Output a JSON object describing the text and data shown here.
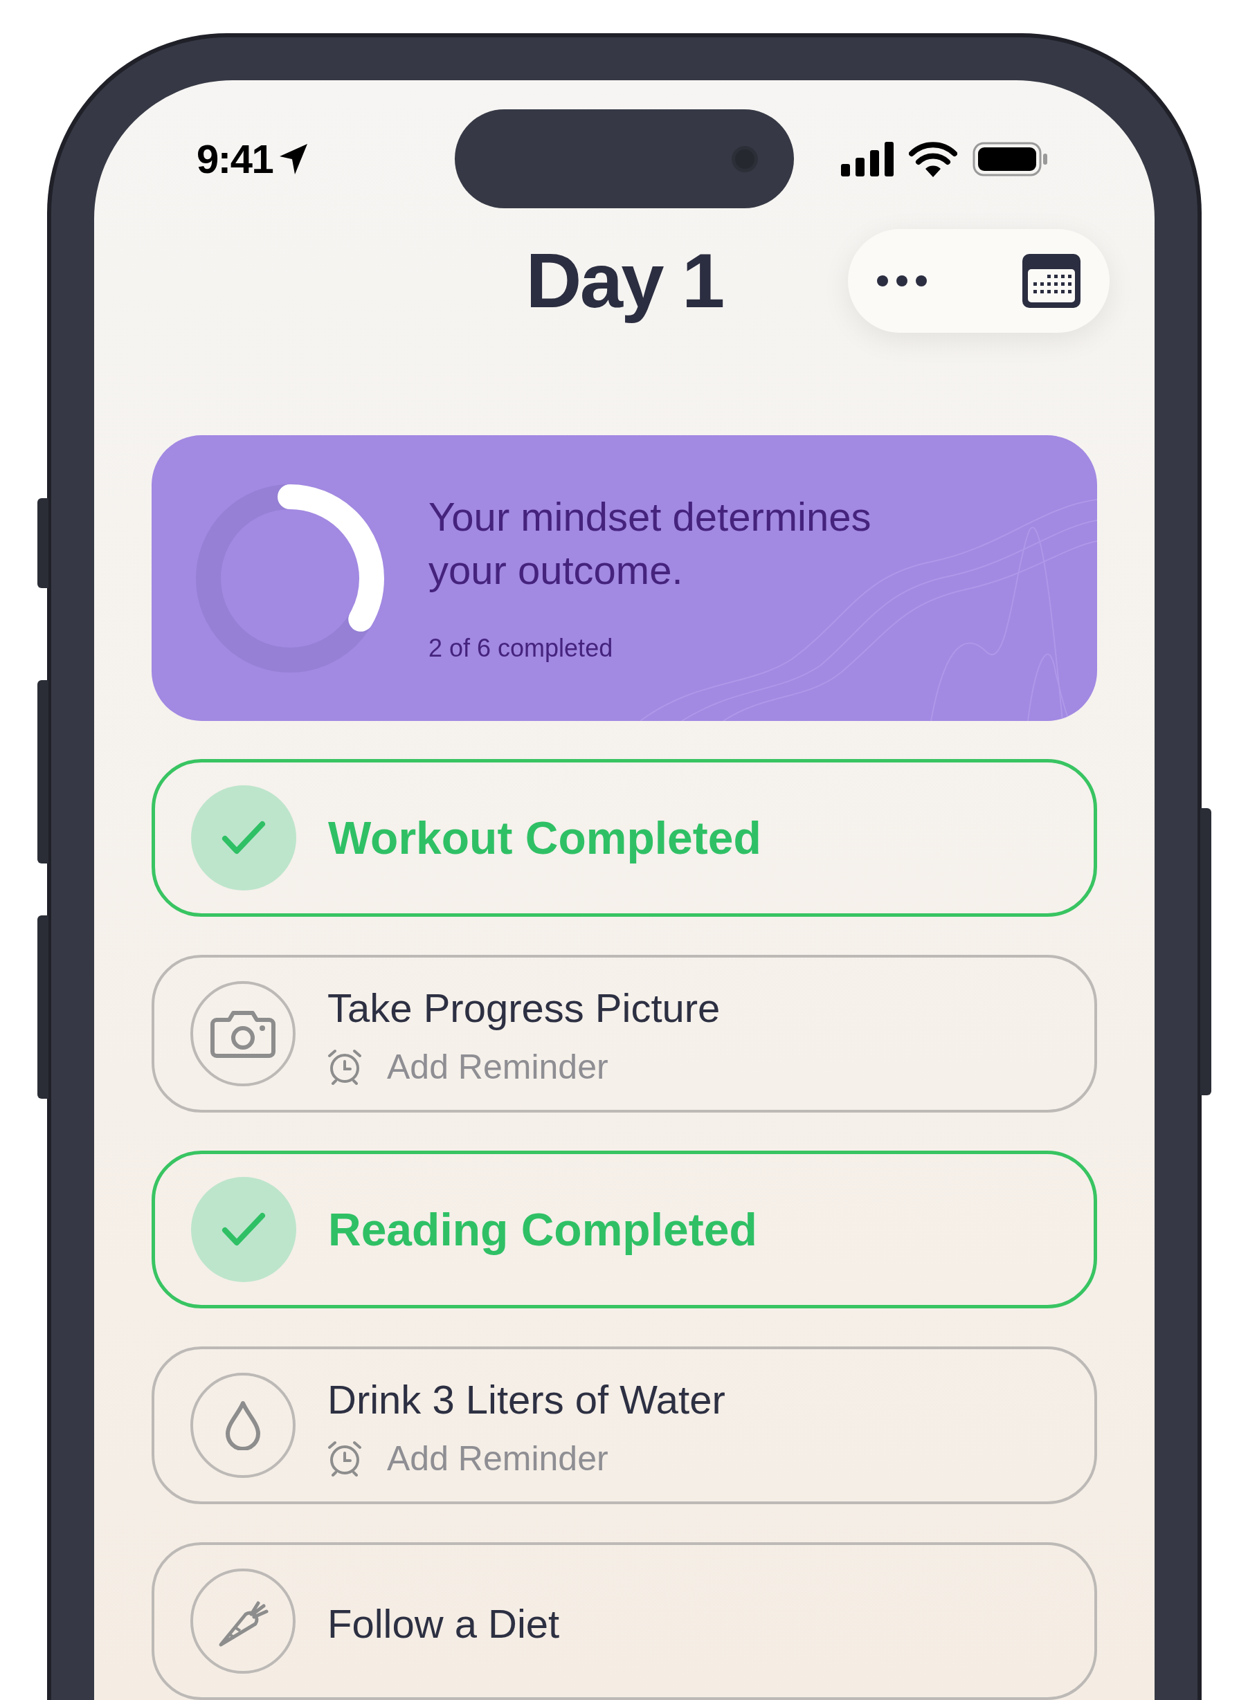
{
  "status_bar": {
    "time": "9:41"
  },
  "header": {
    "title": "Day 1"
  },
  "progress_card": {
    "quote": "Your mindset determines your outcome.",
    "progress_text": "2 of 6 completed",
    "level": 0.333
  },
  "tasks": [
    {
      "title": "Workout Completed",
      "completed": true,
      "kind": "check"
    },
    {
      "title": "Take Progress Picture",
      "completed": false,
      "kind": "camera",
      "reminder": "Add Reminder"
    },
    {
      "title": "Reading Completed",
      "completed": true,
      "kind": "check"
    },
    {
      "title": "Drink 3 Liters of Water",
      "completed": false,
      "kind": "drop",
      "reminder": "Add Reminder"
    },
    {
      "title": "Follow a Diet",
      "completed": false,
      "kind": "carrot"
    }
  ]
}
